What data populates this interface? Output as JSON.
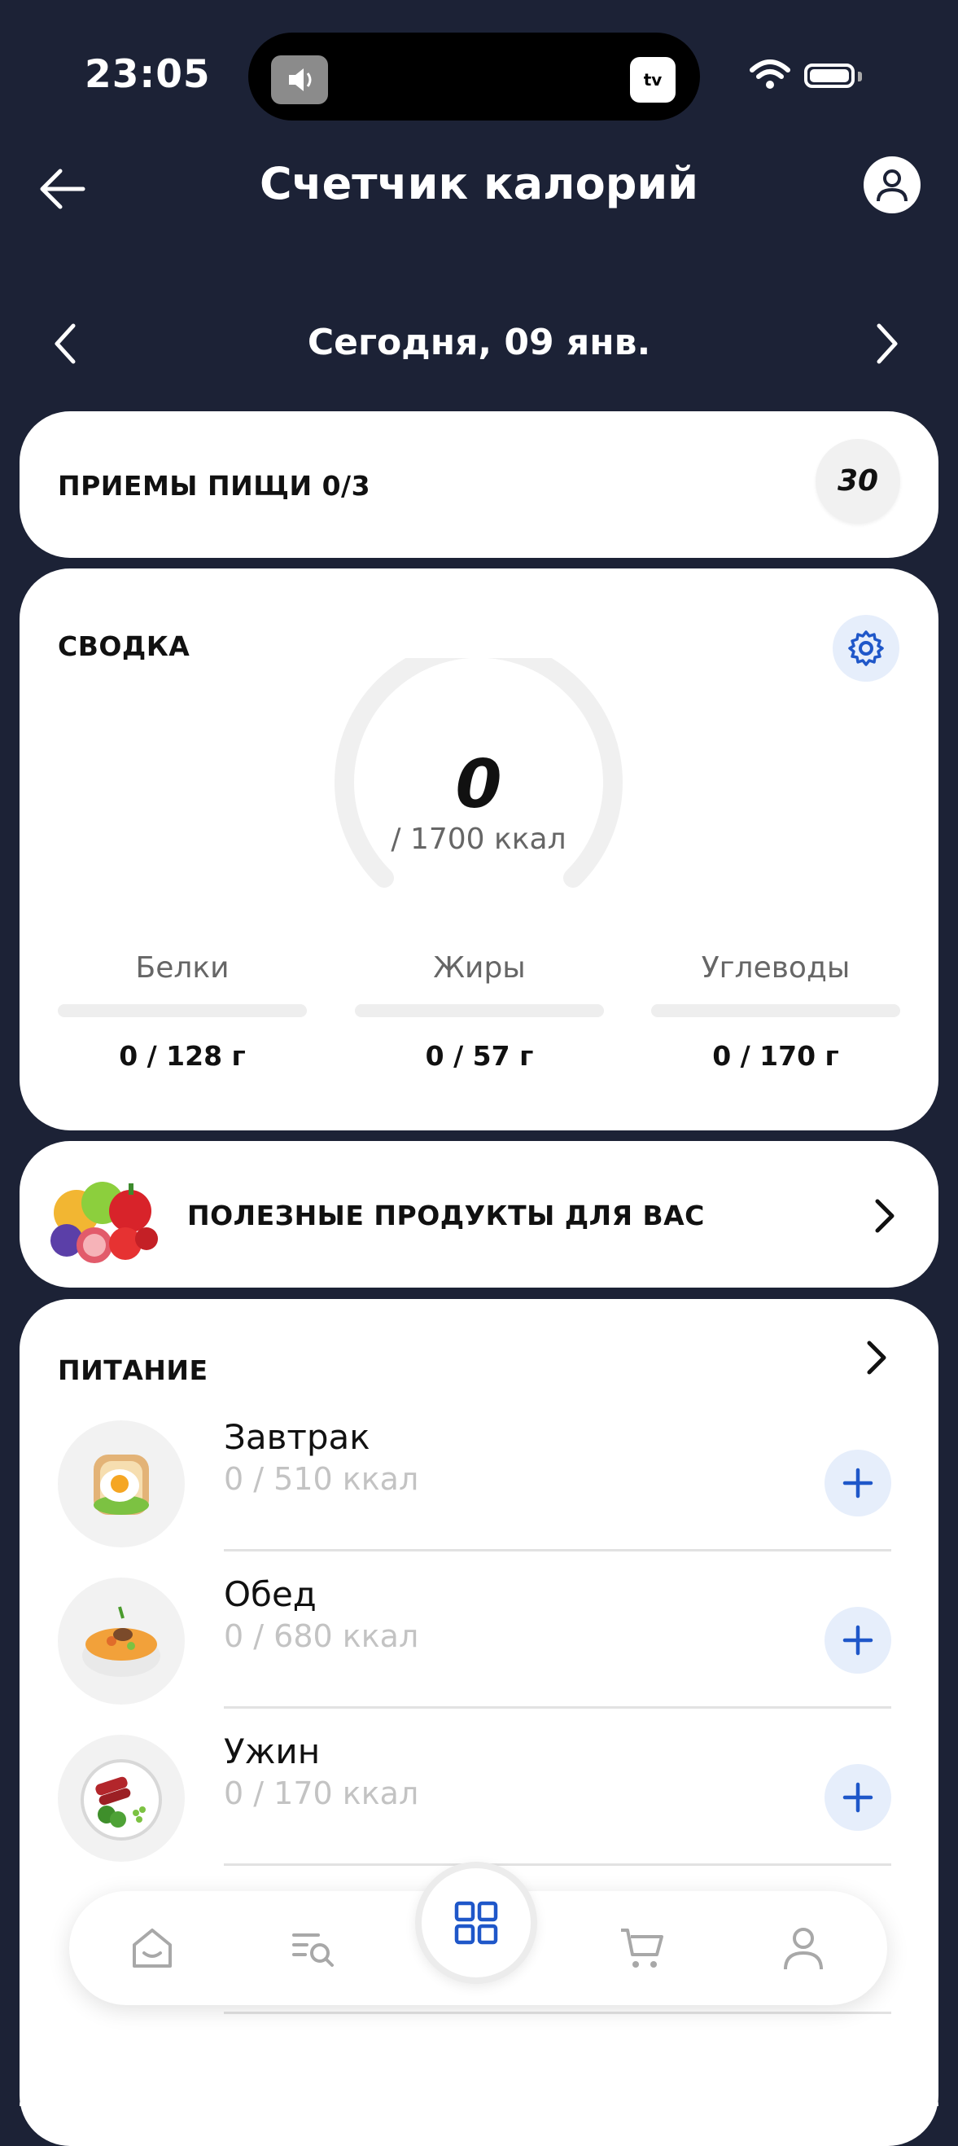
{
  "status_bar": {
    "time": "23:05",
    "tv_label": "tv"
  },
  "header": {
    "title": "Счетчик калорий"
  },
  "date_nav": {
    "label": "Сегодня, 09 янв."
  },
  "meals_card": {
    "label": "ПРИЕМЫ ПИЩИ 0/3",
    "badge": "30"
  },
  "summary": {
    "label": "СВОДКА",
    "calories_value": "0",
    "calories_goal": "/ 1700 ккал",
    "macros": [
      {
        "name": "Белки",
        "value": "0 / 128 г",
        "progress": 0
      },
      {
        "name": "Жиры",
        "value": "0 / 57 г",
        "progress": 0
      },
      {
        "name": "Углеводы",
        "value": "0 / 170 г",
        "progress": 0
      }
    ]
  },
  "healthy_foods": {
    "label": "ПОЛЕЗНЫЕ ПРОДУКТЫ ДЛЯ ВАС"
  },
  "nutrition": {
    "label": "ПИТАНИЕ",
    "meals": [
      {
        "name": "Завтрак",
        "kcal": "0 / 510 ккал"
      },
      {
        "name": "Обед",
        "kcal": "0 / 680 ккал"
      },
      {
        "name": "Ужин",
        "kcal": "0 / 170 ккал"
      }
    ]
  },
  "tab_bar": {
    "items": [
      "home-icon",
      "search-list-icon",
      "grid-icon",
      "cart-icon",
      "profile-icon"
    ],
    "active": "grid-icon",
    "accent": "#1f57c9"
  },
  "colors": {
    "background": "#1c2236",
    "accent": "#1f57c9",
    "card": "#ffffff"
  }
}
